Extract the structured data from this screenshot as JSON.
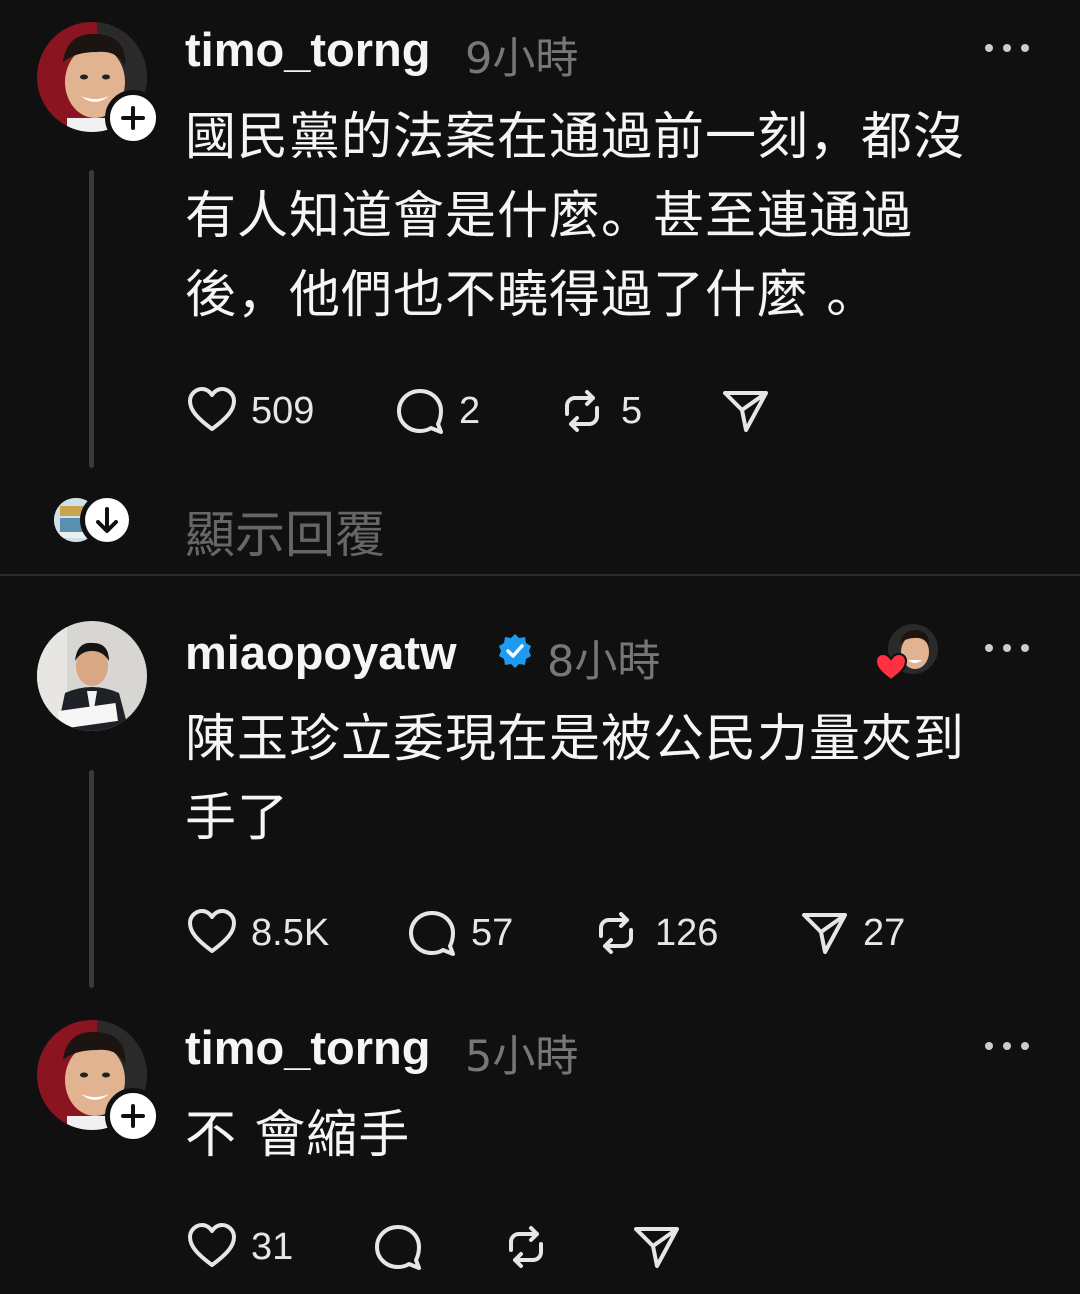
{
  "posts": [
    {
      "username": "timo_torng",
      "time": "9小時",
      "text_lines": [
        "國民黨的法案在通過前一刻，都沒",
        "有人知道會是什麼。甚至連通過",
        "後，他們也不曉得過了什麼 。"
      ],
      "likes": "509",
      "comments": "2",
      "reposts": "5",
      "shares": ""
    },
    {
      "username": "miaopoyatw",
      "verified": true,
      "time": "8小時",
      "text_lines": [
        "陳玉珍立委現在是被公民力量夾到",
        "手了"
      ],
      "likes": "8.5K",
      "comments": "57",
      "reposts": "126",
      "shares": "27"
    },
    {
      "username": "timo_torng",
      "time": "5小時",
      "text_lines": [
        "不 會縮手"
      ],
      "likes": "31",
      "comments": "",
      "reposts": "",
      "shares": ""
    }
  ],
  "show_replies_label": "顯示回覆",
  "icons": {
    "more": "more-horizontal-icon",
    "like": "heart-icon",
    "comment": "comment-bubble-icon",
    "repost": "repost-arrows-icon",
    "share": "send-paper-plane-icon",
    "follow": "plus-icon",
    "verified": "verified-badge-icon",
    "expand": "arrow-down-icon"
  },
  "colors": {
    "background": "#101010",
    "text": "#f3f5f7",
    "muted": "#777777",
    "verified": "#1d9bf0",
    "liked_heart": "#ff3040"
  }
}
